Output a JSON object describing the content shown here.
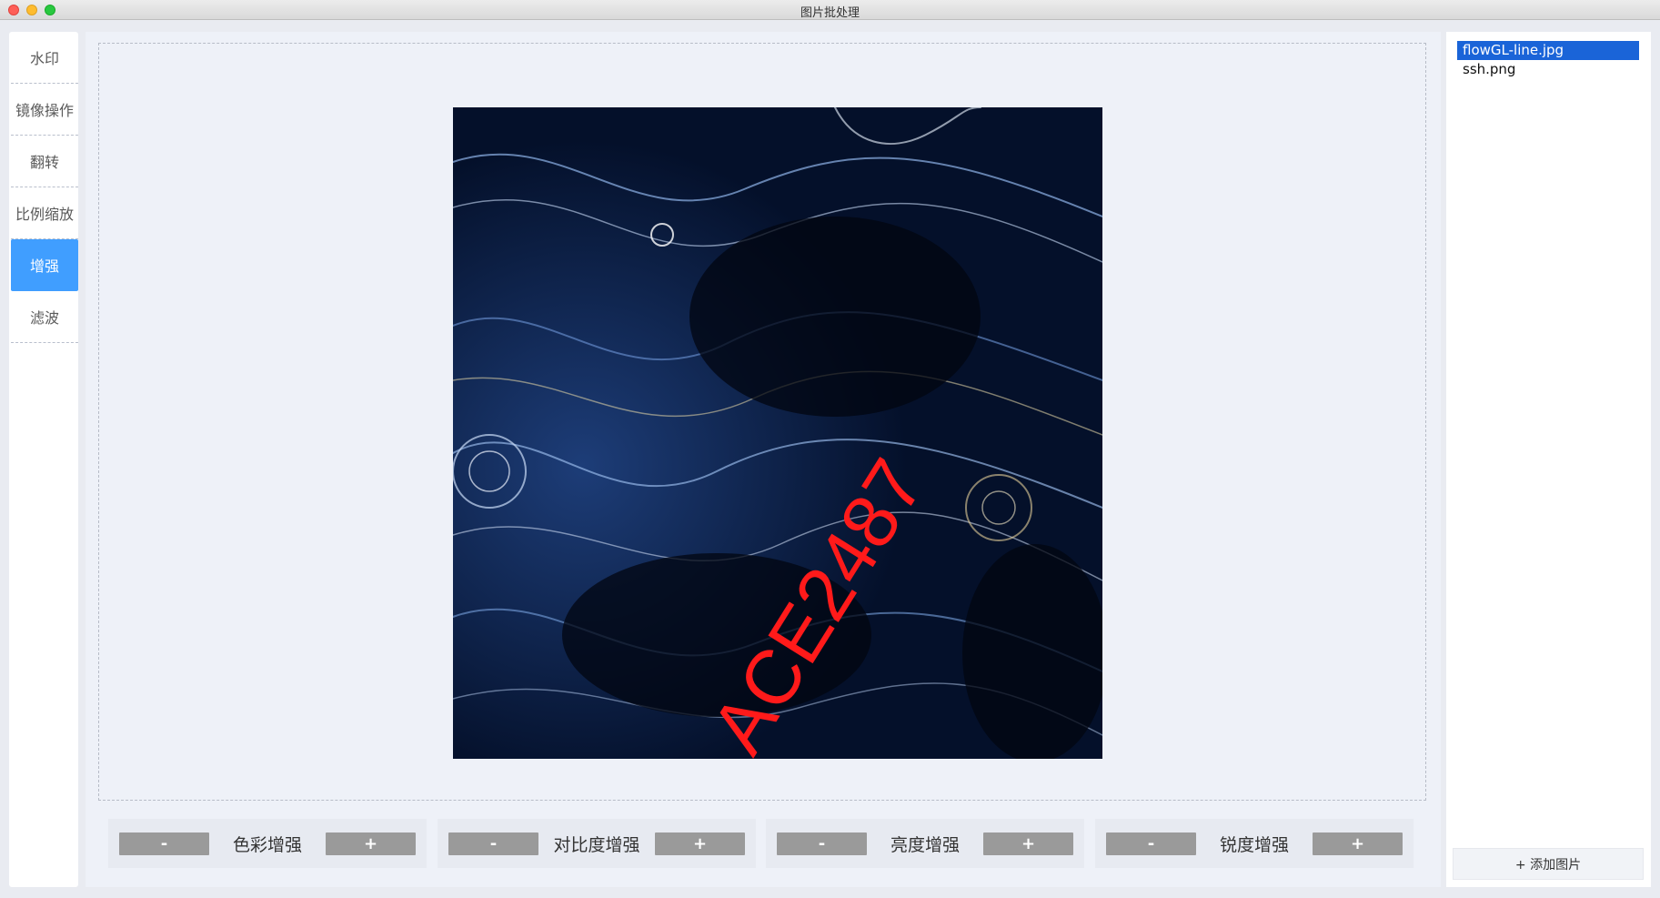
{
  "window": {
    "title": "图片批处理"
  },
  "sidebar": {
    "items": [
      {
        "label": "水印",
        "active": false
      },
      {
        "label": "镜像操作",
        "active": false
      },
      {
        "label": "翻转",
        "active": false
      },
      {
        "label": "比例缩放",
        "active": false
      },
      {
        "label": "增强",
        "active": true
      },
      {
        "label": "滤波",
        "active": false
      }
    ]
  },
  "preview": {
    "image_description_icon": "image-preview",
    "watermark_text": "ACE2487"
  },
  "controls": [
    {
      "minus": "-",
      "label": "色彩增强",
      "plus": "+"
    },
    {
      "minus": "-",
      "label": "对比度增强",
      "plus": "+"
    },
    {
      "minus": "-",
      "label": "亮度增强",
      "plus": "+"
    },
    {
      "minus": "-",
      "label": "锐度增强",
      "plus": "+"
    }
  ],
  "files": {
    "items": [
      {
        "name": "flowGL-line.jpg",
        "selected": true
      },
      {
        "name": "ssh.png",
        "selected": false
      }
    ],
    "add_label": "+ 添加图片"
  },
  "colors": {
    "accent": "#409eff",
    "selection": "#1a64d8",
    "button": "#9a9a9a",
    "watermark": "#ff1a1a"
  }
}
